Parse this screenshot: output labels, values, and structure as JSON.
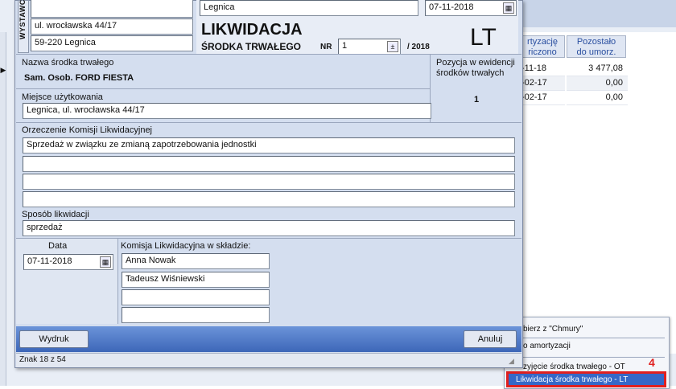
{
  "issuer": {
    "vertical_label": "WYSTAWCA",
    "address_line": "ul. wrocławska 44/17",
    "postal_line": "59-220 Legnica"
  },
  "header": {
    "place": "Legnica",
    "doc_date": "07-11-2018",
    "title_main": "LIKWIDACJA",
    "title_sub": "ŚRODKA TRWAŁEGO",
    "nr_label": "NR",
    "nr_value": "1",
    "year_suffix": "/ 2018",
    "doc_type": "LT"
  },
  "asset": {
    "name_label": "Nazwa środka trwałego",
    "name_value": "Sam. Osob. FORD FIESTA",
    "position_label": "Pozycja w ewidencji środków trwałych",
    "position_value": "1",
    "location_label": "Miejsce użytkowania",
    "location_value": "Legnica, ul. wrocławska 44/17"
  },
  "commission_ruling": {
    "label": "Orzeczenie Komisji Likwidacyjnej",
    "lines": [
      "Sprzedaż w związku ze zmianą zapotrzebowania jednostki",
      "",
      "",
      ""
    ]
  },
  "liquidation_method": {
    "label": "Sposób likwidacji",
    "value": "sprzedaż"
  },
  "date_section": {
    "label": "Data",
    "value": "07-11-2018"
  },
  "commission": {
    "label": "Komisja Likwidacyjna w składzie:",
    "members": [
      "Anna Nowak",
      "Tadeusz Wiśniewski",
      "",
      ""
    ]
  },
  "buttons": {
    "print": "Wydruk",
    "cancel": "Anuluj"
  },
  "status": {
    "char_count": "Znak 18 z 54"
  },
  "background_grid": {
    "col1_header": "rtyzację\nriczono",
    "col2_header": "Pozostało\ndo umorz.",
    "rows": [
      {
        "date": "-11-18",
        "value": "3 477,08"
      },
      {
        "date": "-02-17",
        "value": "0,00"
      },
      {
        "date": "-02-17",
        "value": "0,00"
      }
    ]
  },
  "context_menu": {
    "items": [
      {
        "label": "bierz z \"Chmury\""
      },
      {
        "label": "o amortyzacji"
      },
      {
        "label": "zyjęcie środka trwałego - OT"
      },
      {
        "label": "Likwidacja środka trwałego - LT"
      }
    ],
    "step_marker": "4"
  },
  "colors": {
    "form_bg": "#d4deef",
    "header_bg": "#e8edf6",
    "highlight_border": "#e02020",
    "button_bar": "#4f79c6"
  }
}
